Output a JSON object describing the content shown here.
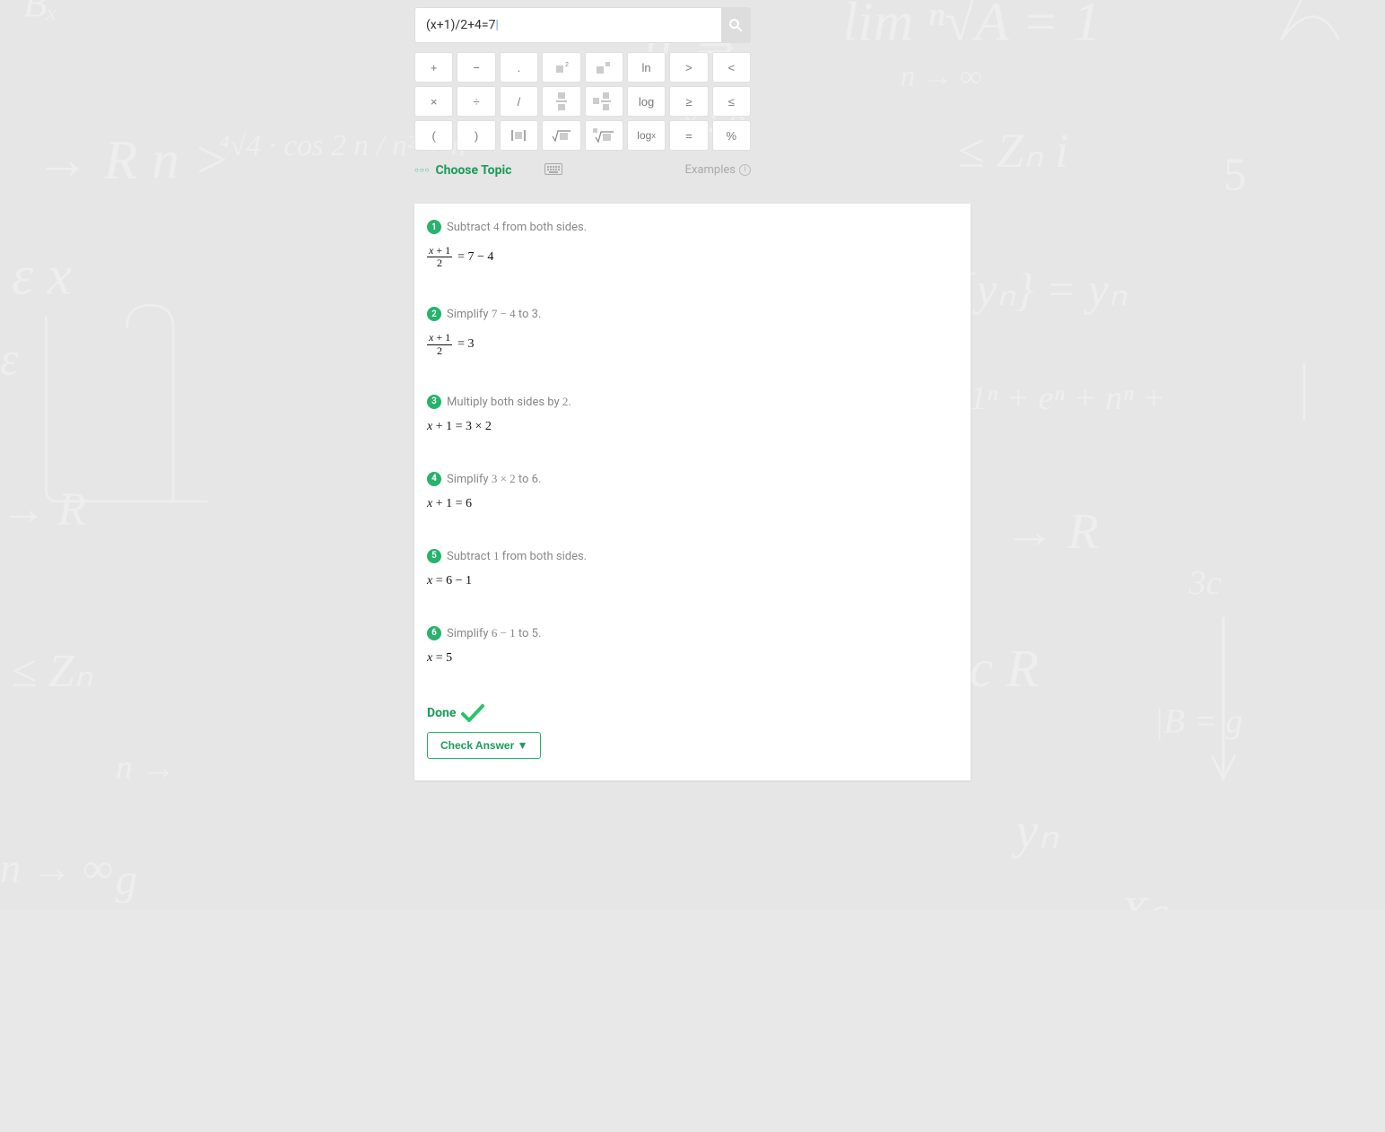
{
  "search": {
    "value": "(x+1)/2+4=7"
  },
  "keypad": {
    "rows": [
      [
        "+",
        "−",
        ".",
        "sq",
        "sqsq",
        "ln",
        ">",
        "<"
      ],
      [
        "×",
        "÷",
        "/",
        "fracbox",
        "mixedfrac",
        "log",
        "≥",
        "≤"
      ],
      [
        "(",
        ")",
        "abs",
        "sqrt",
        "nroot",
        "logx",
        "=",
        "%"
      ]
    ]
  },
  "topicrow": {
    "choose": "Choose Topic",
    "examples": "Examples"
  },
  "steps": [
    {
      "n": "1",
      "text_before": "Subtract ",
      "mid": "4",
      "text_after": " from both sides.",
      "math_html": "frac1eq74"
    },
    {
      "n": "2",
      "text_before": "Simplify  ",
      "mid": "7 − 4",
      "text_after": "  to  3.",
      "math_html": "frac1eq3"
    },
    {
      "n": "3",
      "text_before": "Multiply both sides by ",
      "mid": "2",
      "text_after": ".",
      "math_html": "xp1eq3t2"
    },
    {
      "n": "4",
      "text_before": "Simplify  ",
      "mid": "3 × 2",
      "text_after": "  to  6.",
      "math_html": "xp1eq6"
    },
    {
      "n": "5",
      "text_before": "Subtract ",
      "mid": "1",
      "text_after": " from both sides.",
      "math_html": "xeq6m1"
    },
    {
      "n": "6",
      "text_before": "Simplify  ",
      "mid": "6 − 1",
      "text_after": "  to  5.",
      "math_html": "xeq5"
    }
  ],
  "done": "Done",
  "check": "Check Answer ▼"
}
